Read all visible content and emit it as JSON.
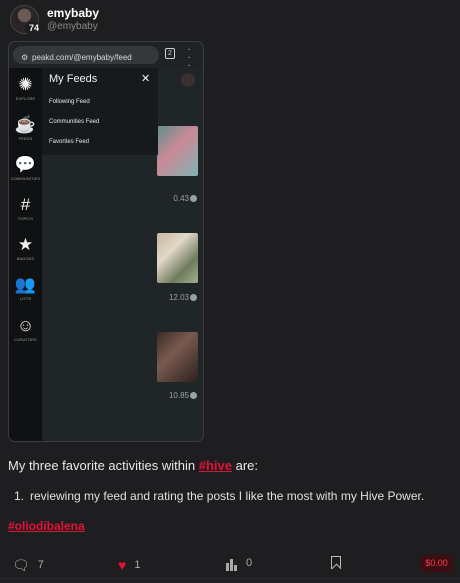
{
  "author": {
    "name": "emybaby",
    "handle": "@emybaby",
    "reputation": "74"
  },
  "screenshot": {
    "url": "peakd.com/@emybaby/feed",
    "tab_count": "2",
    "sidebar": [
      {
        "label": "EXPLORE",
        "icon": "compass-icon"
      },
      {
        "label": "FEEDS",
        "icon": "coffee-icon"
      },
      {
        "label": "COMMUNITIES",
        "icon": "chat-bubbles-icon"
      },
      {
        "label": "TOPICS",
        "icon": "hash-icon"
      },
      {
        "label": "BADGES",
        "icon": "badge-icon"
      },
      {
        "label": "LISTS",
        "icon": "users-icon"
      },
      {
        "label": "CURATORS",
        "icon": "brain-icon"
      }
    ],
    "feeds_menu": {
      "title": "My Feeds",
      "items": [
        "Following Feed",
        "Communities Feed",
        "Favorites Feed"
      ]
    },
    "payouts": [
      "0.43",
      "12.03",
      "10.85"
    ]
  },
  "post": {
    "intro_before": "My three favorite activities within ",
    "intro_tag": "#hive",
    "intro_after": " are:",
    "list_number": "1.",
    "list_item": "reviewing my feed and rating the posts I like the most with my Hive Power.",
    "tag": "#oliodibalena"
  },
  "actions": {
    "comments": "7",
    "likes": "1",
    "votes": "0",
    "payout": "$0.00"
  },
  "colors": {
    "accent": "#e31337",
    "background": "#1e1e20"
  }
}
